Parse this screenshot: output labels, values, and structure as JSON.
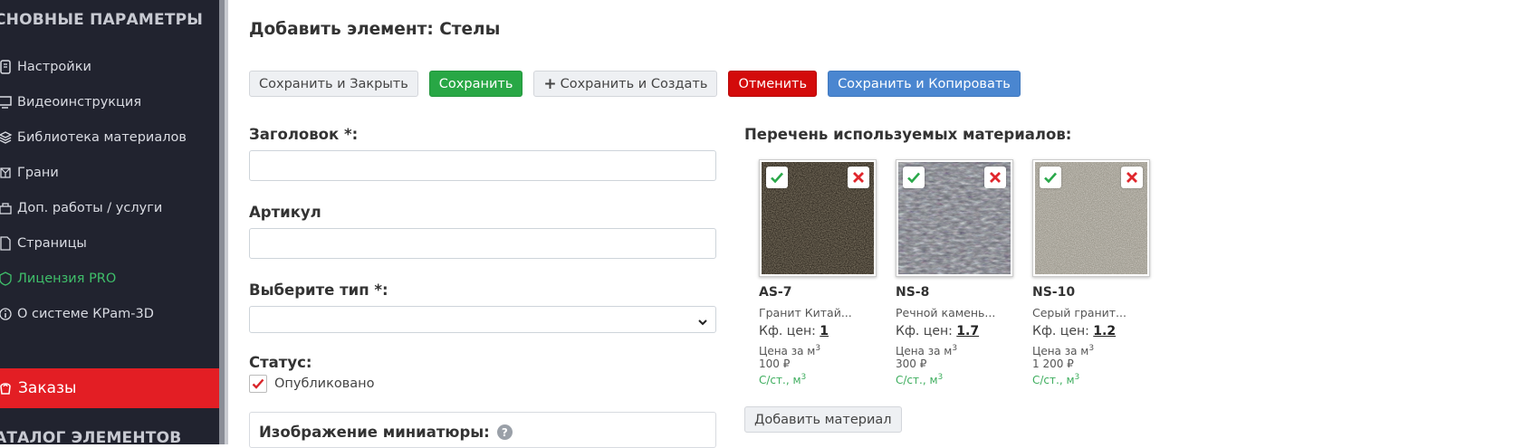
{
  "sidebar": {
    "heading_top": "СНОВНЫЕ ПАРАМЕТРЫ",
    "items": [
      {
        "label": "Настройки",
        "icon": "settings-icon"
      },
      {
        "label": "Видеоинструкция",
        "icon": "monitor-icon"
      },
      {
        "label": "Библиотека материалов",
        "icon": "layers-icon"
      },
      {
        "label": "Грани",
        "icon": "facets-icon"
      },
      {
        "label": "Доп. работы / услуги",
        "icon": "services-icon"
      },
      {
        "label": "Страницы",
        "icon": "page-icon"
      },
      {
        "label": "Лицензия PRO",
        "icon": "license-icon"
      },
      {
        "label": "О системе КРаm-3D",
        "icon": "info-icon"
      }
    ],
    "orders_label": "Заказы",
    "heading_bottom": "АТАЛОГ ЭЛЕМЕНТОВ"
  },
  "page": {
    "title": "Добавить элемент: Стелы"
  },
  "toolbar": {
    "save_close": "Сохранить и Закрыть",
    "save": "Сохранить",
    "save_create": "Сохранить и Создать",
    "cancel": "Отменить",
    "save_copy": "Сохранить и Копировать"
  },
  "form": {
    "title_label": "Заголовок *:",
    "title_value": "",
    "article_label": "Артикул",
    "article_value": "",
    "type_label": "Выберите тип *:",
    "type_value": "",
    "status_label": "Статус:",
    "published_label": "Опубликовано",
    "published_checked": true,
    "thumbnail_label": "Изображение миниатюры:"
  },
  "materials": {
    "title": "Перечень используемых материалов:",
    "coef_label": "Кф. цен:",
    "price_label": "Цена за м",
    "link_label": "С/ст., м",
    "items": [
      {
        "code": "AS-7",
        "name": "Гранит Китай...",
        "coef": "1",
        "price": "100 ₽",
        "texture": "dark-brown"
      },
      {
        "code": "NS-8",
        "name": "Речной камень...",
        "coef": "1.7",
        "price": "300 ₽",
        "texture": "grey-mottled"
      },
      {
        "code": "NS-10",
        "name": "Серый гранит...",
        "coef": "1.2",
        "price": "1 200 ₽",
        "texture": "grey-speckled"
      }
    ],
    "add_button": "Добавить материал"
  },
  "colors": {
    "sidebar_bg": "#21232f",
    "orders_bg": "#e31e24",
    "save_green": "#28a745",
    "cancel_red": "#d30b0b",
    "copy_blue": "#4a86d0",
    "license_green": "#3fbf6a"
  }
}
